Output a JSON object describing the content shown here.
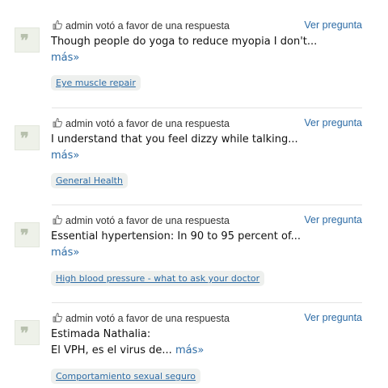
{
  "activity": [
    {
      "meta": "admin votó a favor de una respuesta",
      "view_link": "Ver pregunta",
      "excerpt": "Though people do yoga to reduce myopia I don't...",
      "more": "más»",
      "tag": "Eye muscle repair"
    },
    {
      "meta": "admin votó a favor de una respuesta",
      "view_link": "Ver pregunta",
      "excerpt": "I understand that you feel dizzy while talking...",
      "more": "más»",
      "tag": "General Health"
    },
    {
      "meta": "admin votó a favor de una respuesta",
      "view_link": "Ver pregunta",
      "excerpt": "Essential hypertension: In 90 to 95 percent of...",
      "more": "más»",
      "tag": "High blood pressure - what to ask your doctor"
    },
    {
      "meta": "admin votó a favor de una respuesta",
      "view_link": "Ver pregunta",
      "excerpt_line1": "Estimada Nathalia:",
      "excerpt_line2": "El VPH, es el virus de...",
      "more": "más»",
      "tag": "Comportamiento sexual seguro"
    }
  ],
  "icons": {
    "avatar": "default-user-avatar-icon",
    "vote": "thumbs-up-hand-icon"
  },
  "colors": {
    "link": "#2c6ba5",
    "tag_bg": "#eef0ee",
    "separator": "#e3e3e3"
  }
}
